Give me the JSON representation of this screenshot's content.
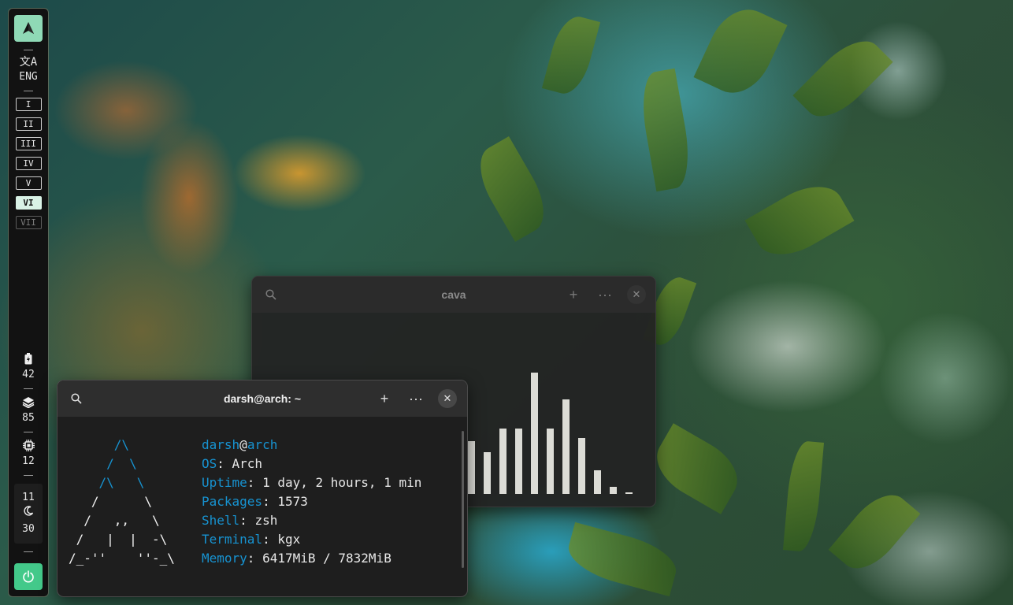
{
  "sidebar": {
    "logo_icon": "arch-logo-icon",
    "language": {
      "icon": "translate-icon",
      "label": "ENG"
    },
    "workspaces": [
      {
        "label": "I",
        "state": "normal"
      },
      {
        "label": "II",
        "state": "normal"
      },
      {
        "label": "III",
        "state": "normal"
      },
      {
        "label": "IV",
        "state": "normal"
      },
      {
        "label": "V",
        "state": "normal"
      },
      {
        "label": "VI",
        "state": "active"
      },
      {
        "label": "VII",
        "state": "empty"
      }
    ],
    "battery": {
      "icon": "battery-icon",
      "value": "42"
    },
    "memory": {
      "icon": "layers-icon",
      "value": "85"
    },
    "cpu": {
      "icon": "cpu-icon",
      "value": "12"
    },
    "clock": {
      "hour": "11",
      "icon": "moon-icon",
      "minute": "30"
    },
    "power_icon": "power-icon"
  },
  "cava_window": {
    "title": "cava",
    "bar_levels": [
      0.29,
      0.23,
      0.36,
      0.36,
      0.67,
      0.36,
      0.52,
      0.31,
      0.13,
      0.04,
      0.01
    ]
  },
  "terminal_window": {
    "title": "darsh@arch: ~",
    "ascii_logo": [
      "      /\\",
      "     /  \\",
      "    /\\   \\",
      "   /      \\",
      "  /   ,,   \\",
      " /   |  |  -\\",
      "/_-''    ''-_\\"
    ],
    "user": "darsh",
    "at": "@",
    "host": "arch",
    "info": [
      {
        "key": "OS",
        "value": "Arch"
      },
      {
        "key": "Uptime",
        "value": "1 day, 2 hours, 1 min"
      },
      {
        "key": "Packages",
        "value": "1573"
      },
      {
        "key": "Shell",
        "value": "zsh"
      },
      {
        "key": "Terminal",
        "value": "kgx"
      },
      {
        "key": "Memory",
        "value": "6417MiB / 7832MiB"
      }
    ]
  }
}
